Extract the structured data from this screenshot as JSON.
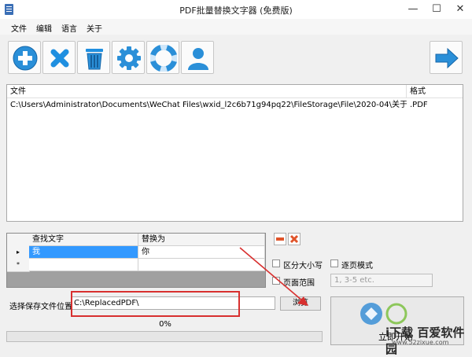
{
  "window": {
    "title": "PDF批量替换文字器 (免费版)",
    "minimize": "—",
    "maximize": "☐",
    "close": "✕"
  },
  "menu": [
    "文件",
    "编辑",
    "语言",
    "关于"
  ],
  "toolbar": {
    "buttons": [
      {
        "icon": "add-icon"
      },
      {
        "icon": "remove-icon"
      },
      {
        "icon": "trash-icon"
      },
      {
        "icon": "settings-gear-icon"
      },
      {
        "icon": "help-lifebuoy-icon"
      },
      {
        "icon": "user-icon"
      }
    ],
    "next": {
      "icon": "arrow-right-icon"
    }
  },
  "file_list": {
    "headers": {
      "file": "文件",
      "format": "格式"
    },
    "rows": [
      {
        "file": "C:\\Users\\Administrator\\Documents\\WeChat Files\\wxid_l2c6b71g94pq22\\FileStorage\\File\\2020-04\\关于组织...",
        "format": ".PDF"
      }
    ]
  },
  "replace_grid": {
    "headers": {
      "find": "查找文字",
      "replace": "替换为"
    },
    "rows": [
      {
        "marker": "▸",
        "find": "我",
        "replace": "你"
      },
      {
        "marker": "*",
        "find": "",
        "replace": ""
      }
    ]
  },
  "options": {
    "case_sensitive": "区分大小写",
    "page_mode": "逐页模式",
    "page_range": "页面范围",
    "page_range_placeholder": "1, 3-5 etc."
  },
  "output": {
    "label": "选择保存文件位置",
    "path": "C:\\ReplacedPDF\\",
    "browse": "浏览"
  },
  "progress": {
    "text": "0%",
    "value": 0
  },
  "start_button": {
    "label": "立即开始"
  },
  "watermark": {
    "text": "i下载 百爱软件园",
    "url": "www.52zixue.com"
  },
  "colors": {
    "accent_blue": "#2a8fd8",
    "highlight_red": "#d8302f",
    "toolbar_icon_blue": "#1f8fe0"
  }
}
